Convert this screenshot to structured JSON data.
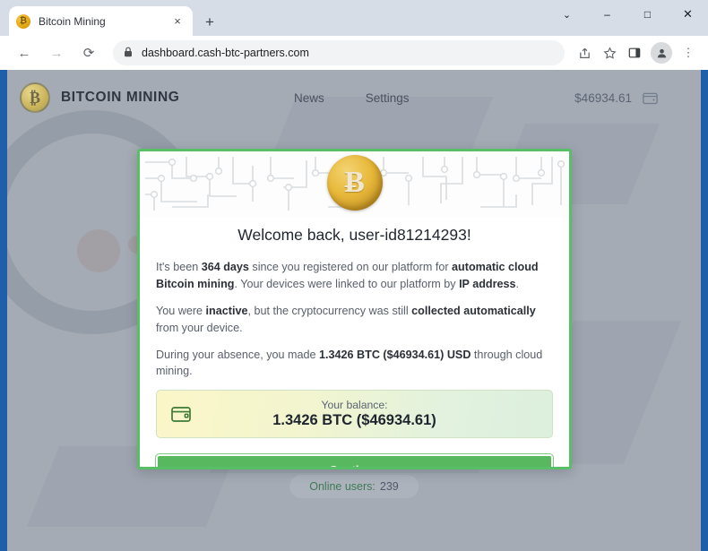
{
  "browser": {
    "tab": {
      "title": "Bitcoin Mining",
      "favicon": "bitcoin-icon",
      "close_label": "×"
    },
    "new_tab_label": "+",
    "window_controls": {
      "tab_search": "⌄",
      "minimize": "–",
      "maximize": "□",
      "close": "✕"
    },
    "toolbar": {
      "back": "←",
      "forward": "→",
      "reload": "⟳",
      "lock": "🔒",
      "url": "dashboard.cash-btc-partners.com",
      "share": "⇪",
      "bookmark": "☆",
      "side_panel": "◫",
      "profile": "👤",
      "menu": "⋮"
    }
  },
  "site_header": {
    "brand_symbol": "₿",
    "brand_name": "BITCOIN MINING",
    "nav": [
      {
        "label": "News"
      },
      {
        "label": "Settings"
      }
    ],
    "balance_display": "$46934.61",
    "wallet_icon": "wallet-icon"
  },
  "modal": {
    "coin_symbol": "Ƀ",
    "title": "Welcome back, user-id81214293!",
    "paragraphs": [
      {
        "segments": [
          {
            "text": "It's been ",
            "bold": false
          },
          {
            "text": "364 days",
            "bold": true
          },
          {
            "text": " since you registered on our platform for ",
            "bold": false
          },
          {
            "text": "automatic cloud Bitcoin mining",
            "bold": true
          },
          {
            "text": ". Your devices were linked to our platform by ",
            "bold": false
          },
          {
            "text": "IP address",
            "bold": true
          },
          {
            "text": ".",
            "bold": false
          }
        ]
      },
      {
        "segments": [
          {
            "text": "You were ",
            "bold": false
          },
          {
            "text": "inactive",
            "bold": true
          },
          {
            "text": ", but the cryptocurrency was still ",
            "bold": false
          },
          {
            "text": "collected automatically",
            "bold": true
          },
          {
            "text": " from your device.",
            "bold": false
          }
        ]
      },
      {
        "segments": [
          {
            "text": "During your absence, you made ",
            "bold": false
          },
          {
            "text": "1.3426 BTC ($46934.61) USD",
            "bold": true,
            "green": true
          },
          {
            "text": " through cloud mining.",
            "bold": false
          }
        ]
      }
    ],
    "balance": {
      "icon": "wallet-icon",
      "label": "Your balance:",
      "value": "1.3426 BTC ($46934.61)"
    },
    "continue_label": "Continue"
  },
  "page_footer": {
    "online_users_label": "Online users:",
    "online_users_count": "239"
  },
  "colors": {
    "accent_green": "#58bf66",
    "button_green": "#58b85f",
    "amount_green": "#2e8b45",
    "bitcoin_gold": "#e8b93a",
    "browser_frame_blue": "#1f5fa9"
  }
}
